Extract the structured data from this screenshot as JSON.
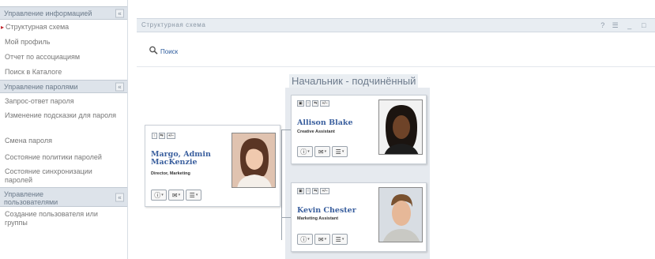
{
  "sidebar": {
    "sections": [
      {
        "title": "Управление информацией",
        "items": [
          {
            "label": "Структурная схема",
            "active": true
          },
          {
            "label": "Мой профиль"
          },
          {
            "label": "Отчет по ассоциациям"
          },
          {
            "label": "Поиск в Каталоге"
          }
        ]
      },
      {
        "title": "Управление паролями",
        "items": [
          {
            "label": "Запрос-ответ пароля"
          },
          {
            "label": "Изменение подсказки для пароля"
          },
          {
            "label": "Смена пароля"
          },
          {
            "label": "Состояние политики паролей"
          },
          {
            "label": "Состояние синхронизации паролей"
          }
        ]
      },
      {
        "title": "Управление пользователями",
        "items": [
          {
            "label": "Создание пользователя или группы"
          }
        ]
      }
    ],
    "collapse_glyph": "«"
  },
  "panel": {
    "title": "Структурная схема",
    "controls": [
      "?",
      "☰",
      "_",
      "□"
    ]
  },
  "toolbar": {
    "search_label": "Поиск"
  },
  "org_chart": {
    "relationship_title": "Начальник - подчинённый",
    "top_button_labels": [
      "↑",
      "⇆",
      "+/–"
    ],
    "sub_top_button_labels": [
      "▣",
      "↑",
      "⇆",
      "+/–"
    ],
    "bottom_button_icons": [
      "info-icon",
      "email-icon",
      "org-chart-icon"
    ],
    "manager": {
      "name_line1": "Margo, Admin",
      "name_line2": "MacKenzie",
      "title": "Director, Marketing"
    },
    "reports": [
      {
        "name": "Allison Blake",
        "title": "Creative Assistant"
      },
      {
        "name": "Kevin Chester",
        "title": "Marketing Assistant"
      }
    ]
  }
}
